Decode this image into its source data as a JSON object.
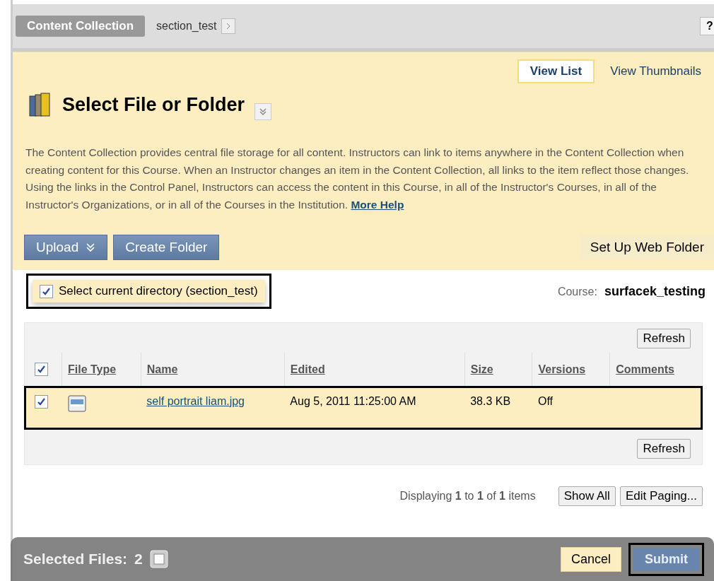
{
  "breadcrumb": {
    "root": "Content Collection",
    "current": "section_test",
    "help": "?"
  },
  "view_toggle": [
    {
      "label": "View List",
      "selected": true
    },
    {
      "label": "View Thumbnails",
      "selected": false
    }
  ],
  "title": "Select File or Folder",
  "description": "The Content Collection provides central file storage for all content. Instructors can link to items anywhere in the Content Collection when creating content for this Course. When an Instructor changes an item in the Content Collection, all links to the item reflect those changes. Using the links in the Control Panel, Instructors can access the content in this Course, in all of the Instructor's Courses, in all of the Instructor's Organizations, or in all of the Courses in the Institution.",
  "more_help": "More Help",
  "toolbar": [
    {
      "label": "Upload",
      "kind": "menu"
    },
    {
      "label": "Create Folder",
      "kind": "plain"
    }
  ],
  "web_folder_button": "Set Up Web Folder",
  "select_directory": {
    "label": "Select current directory (section_test)",
    "checked": true,
    "highlighted": true
  },
  "course": {
    "label": "Course:",
    "value": "surfacek_testing"
  },
  "table": {
    "refresh": "Refresh",
    "select_all_checked": true,
    "columns": [
      "File Type",
      "Name",
      "Edited",
      "Size",
      "Versions",
      "Comments"
    ],
    "rows": [
      {
        "checked": true,
        "highlighted": true,
        "name": "self portrait liam.jpg",
        "edited": "Aug 5, 2011 11:25:00 AM",
        "size": "38.3 KB",
        "versions": "Off"
      }
    ],
    "refresh_bottom": "Refresh"
  },
  "paging": {
    "text": "Displaying **1** to **1** of **1** items",
    "buttons": [
      "Show All",
      "Edit Paging..."
    ]
  },
  "bottom_bar": {
    "label": "Selected Files:",
    "count": "2",
    "cancel": "Cancel",
    "submit": {
      "label": "Submit",
      "highlighted": true
    }
  }
}
